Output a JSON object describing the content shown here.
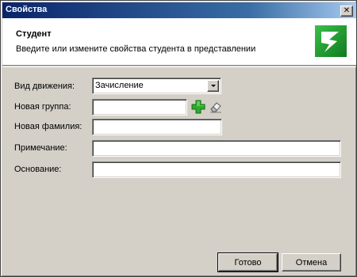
{
  "window": {
    "title": "Свойства"
  },
  "header": {
    "title": "Студент",
    "subtitle": "Введите или измените свойства студента в представлении",
    "logo_icon": "green-lightning-logo-icon"
  },
  "form": {
    "movement": {
      "label": "Вид движения:",
      "value": "Зачисление"
    },
    "new_group": {
      "label": "Новая группа:",
      "value": "",
      "add_icon": "green-plus-icon",
      "clear_icon": "eraser-icon"
    },
    "new_surname": {
      "label": "Новая фамилия:",
      "value": ""
    },
    "note": {
      "label": "Примечание:",
      "value": ""
    },
    "basis": {
      "label": "Основание:",
      "value": ""
    }
  },
  "buttons": {
    "ok": "Готово",
    "cancel": "Отмена"
  },
  "colors": {
    "titlebar_start": "#0a246a",
    "titlebar_end": "#a6caf0",
    "dialog_bg": "#d4d0c8",
    "logo_green": "#1a9a2a",
    "plus_green": "#2eaa2e"
  }
}
